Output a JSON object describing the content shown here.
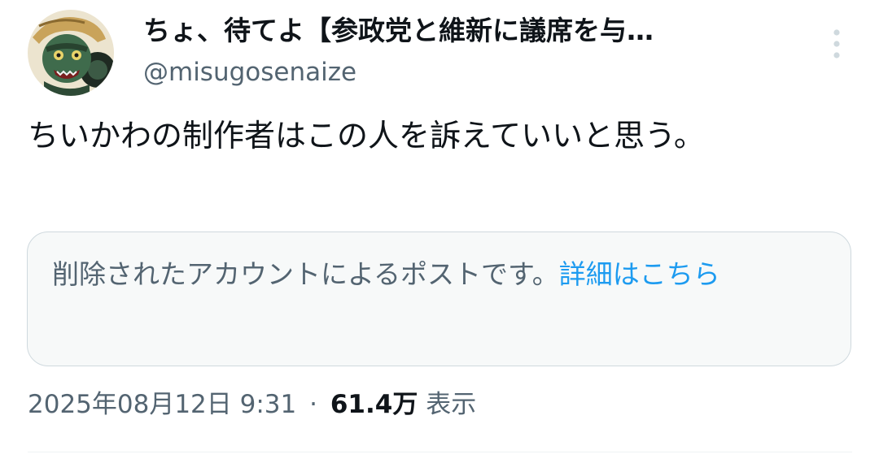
{
  "author": {
    "display_name": "ちょ、待てよ【参政党と維新に議席を与…",
    "handle": "@misugosenaize",
    "avatar_icon": "demon-mask-avatar"
  },
  "more_icon": "more-vertical-icon",
  "tweet": {
    "text": "ちいかわの制作者はこの人を訴えていいと思う。"
  },
  "quoted": {
    "deleted_notice": "削除されたアカウントによるポストです。",
    "learn_more_label": "詳細はこちら"
  },
  "meta": {
    "timestamp": "2025年08月12日 9:31",
    "separator": "·",
    "views_count": "61.4万",
    "views_label": "表示"
  },
  "colors": {
    "text_primary": "#0f1419",
    "text_secondary": "#536471",
    "link": "#1d9bf0",
    "card_border": "#cfd9de",
    "card_background": "#f7f9f9"
  }
}
